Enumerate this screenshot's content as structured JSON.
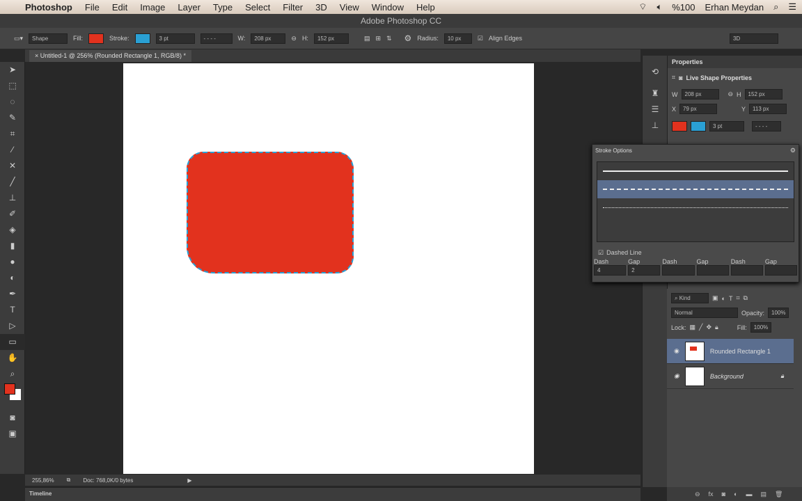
{
  "menubar": {
    "app": "Photoshop",
    "items": [
      "File",
      "Edit",
      "Image",
      "Layer",
      "Type",
      "Select",
      "Filter",
      "3D",
      "View",
      "Window",
      "Help"
    ],
    "battery": "%100",
    "user": "Erhan Meydan"
  },
  "window_title": "Adobe Photoshop CC",
  "options": {
    "mode": "Shape",
    "fill_label": "Fill:",
    "stroke_label": "Stroke:",
    "stroke_width": "3 pt",
    "w_label": "W:",
    "w": "208 px",
    "h_label": "H:",
    "h": "152 px",
    "radius_label": "Radius:",
    "radius": "10 px",
    "align_edges": "Align Edges",
    "workspace": "3D"
  },
  "document_tab": "Untitled-1 @ 256% (Rounded Rectangle 1, RGB/8) *",
  "colors": {
    "fill": "#e2321e",
    "stroke": "#2aa0d4",
    "selection": "#5b6e8f"
  },
  "properties": {
    "title": "Properties",
    "subtitle": "Live Shape Properties",
    "w": "208 px",
    "h": "152 px",
    "x": "79 px",
    "y": "113 px",
    "stroke_width": "3 pt",
    "w_label": "W",
    "h_label": "H",
    "x_label": "X",
    "y_label": "Y"
  },
  "stroke_options": {
    "title": "Stroke Options",
    "dashed_line": "Dashed Line",
    "fields": [
      {
        "label": "Dash",
        "value": "4"
      },
      {
        "label": "Gap",
        "value": "2"
      },
      {
        "label": "Dash",
        "value": ""
      },
      {
        "label": "Gap",
        "value": ""
      },
      {
        "label": "Dash",
        "value": ""
      },
      {
        "label": "Gap",
        "value": ""
      }
    ]
  },
  "layers": {
    "filter": "Kind",
    "blend": "Normal",
    "opacity_label": "Opacity:",
    "opacity": "100%",
    "lock_label": "Lock:",
    "fill_label": "Fill:",
    "fill": "100%",
    "items": [
      {
        "name": "Rounded Rectangle 1"
      },
      {
        "name": "Background"
      }
    ]
  },
  "status": {
    "zoom": "255,86%",
    "doc": "Doc: 768,0K/0 bytes"
  },
  "timeline": "Timeline"
}
